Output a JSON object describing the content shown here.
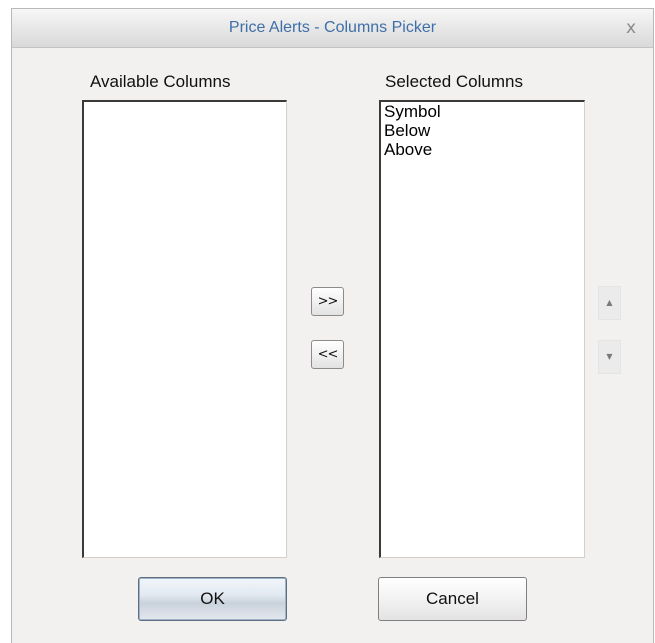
{
  "window": {
    "title": "Price Alerts - Columns Picker",
    "close_glyph": "x"
  },
  "available": {
    "label": "Available Columns",
    "items": []
  },
  "selected": {
    "label": "Selected Columns",
    "items": [
      "Symbol",
      "Below",
      "Above"
    ]
  },
  "transfer": {
    "add_label": ">>",
    "remove_label": "<<"
  },
  "order": {
    "up_icon": "triangle-up-icon",
    "down_icon": "triangle-down-icon",
    "up_glyph": "▲",
    "down_glyph": "▼"
  },
  "buttons": {
    "ok_label": "OK",
    "cancel_label": "Cancel"
  },
  "colors": {
    "title_text": "#3f6fa8",
    "dialog_background": "#f2f1ef"
  }
}
